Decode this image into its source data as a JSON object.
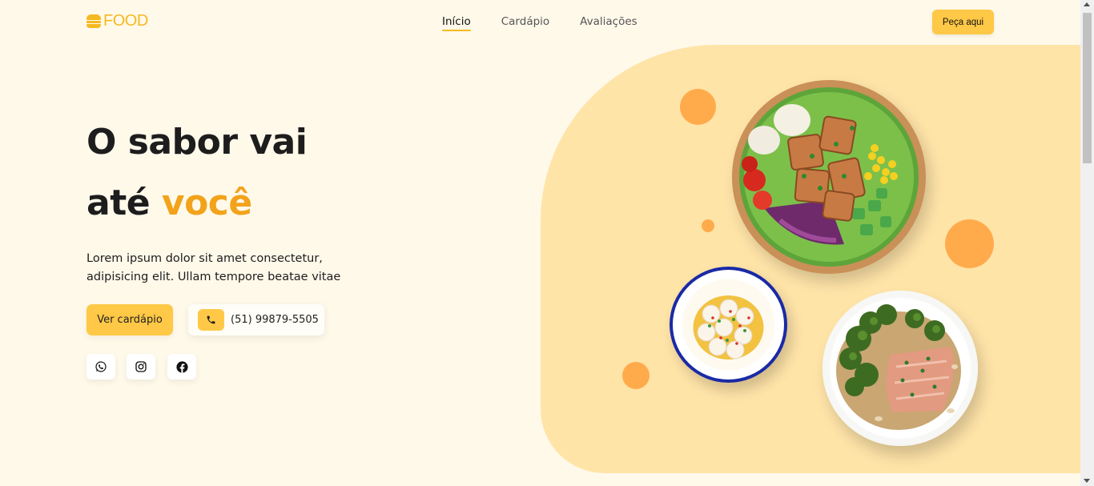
{
  "header": {
    "logo_text": "FOOD",
    "nav": [
      {
        "label": "Início",
        "active": true
      },
      {
        "label": "Cardápio",
        "active": false
      },
      {
        "label": "Avaliações",
        "active": false
      }
    ],
    "order_button": "Peça aqui"
  },
  "hero": {
    "title_line1": "O sabor vai",
    "title_line2_plain": "até ",
    "title_line2_accent": "você",
    "description": "Lorem ipsum dolor sit amet consectetur, adipisicing elit. Ullam tempore beatae vitae",
    "menu_button": "Ver cardápio",
    "phone": "(51) 99879-5505",
    "social_icons": [
      "whatsapp-icon",
      "instagram-icon",
      "facebook-icon"
    ]
  },
  "colors": {
    "background": "#fff9ea",
    "accent": "#ffc846",
    "accent_text": "#f2a31b",
    "blob": "#ffe4a8",
    "dots": "#ffab4c"
  }
}
